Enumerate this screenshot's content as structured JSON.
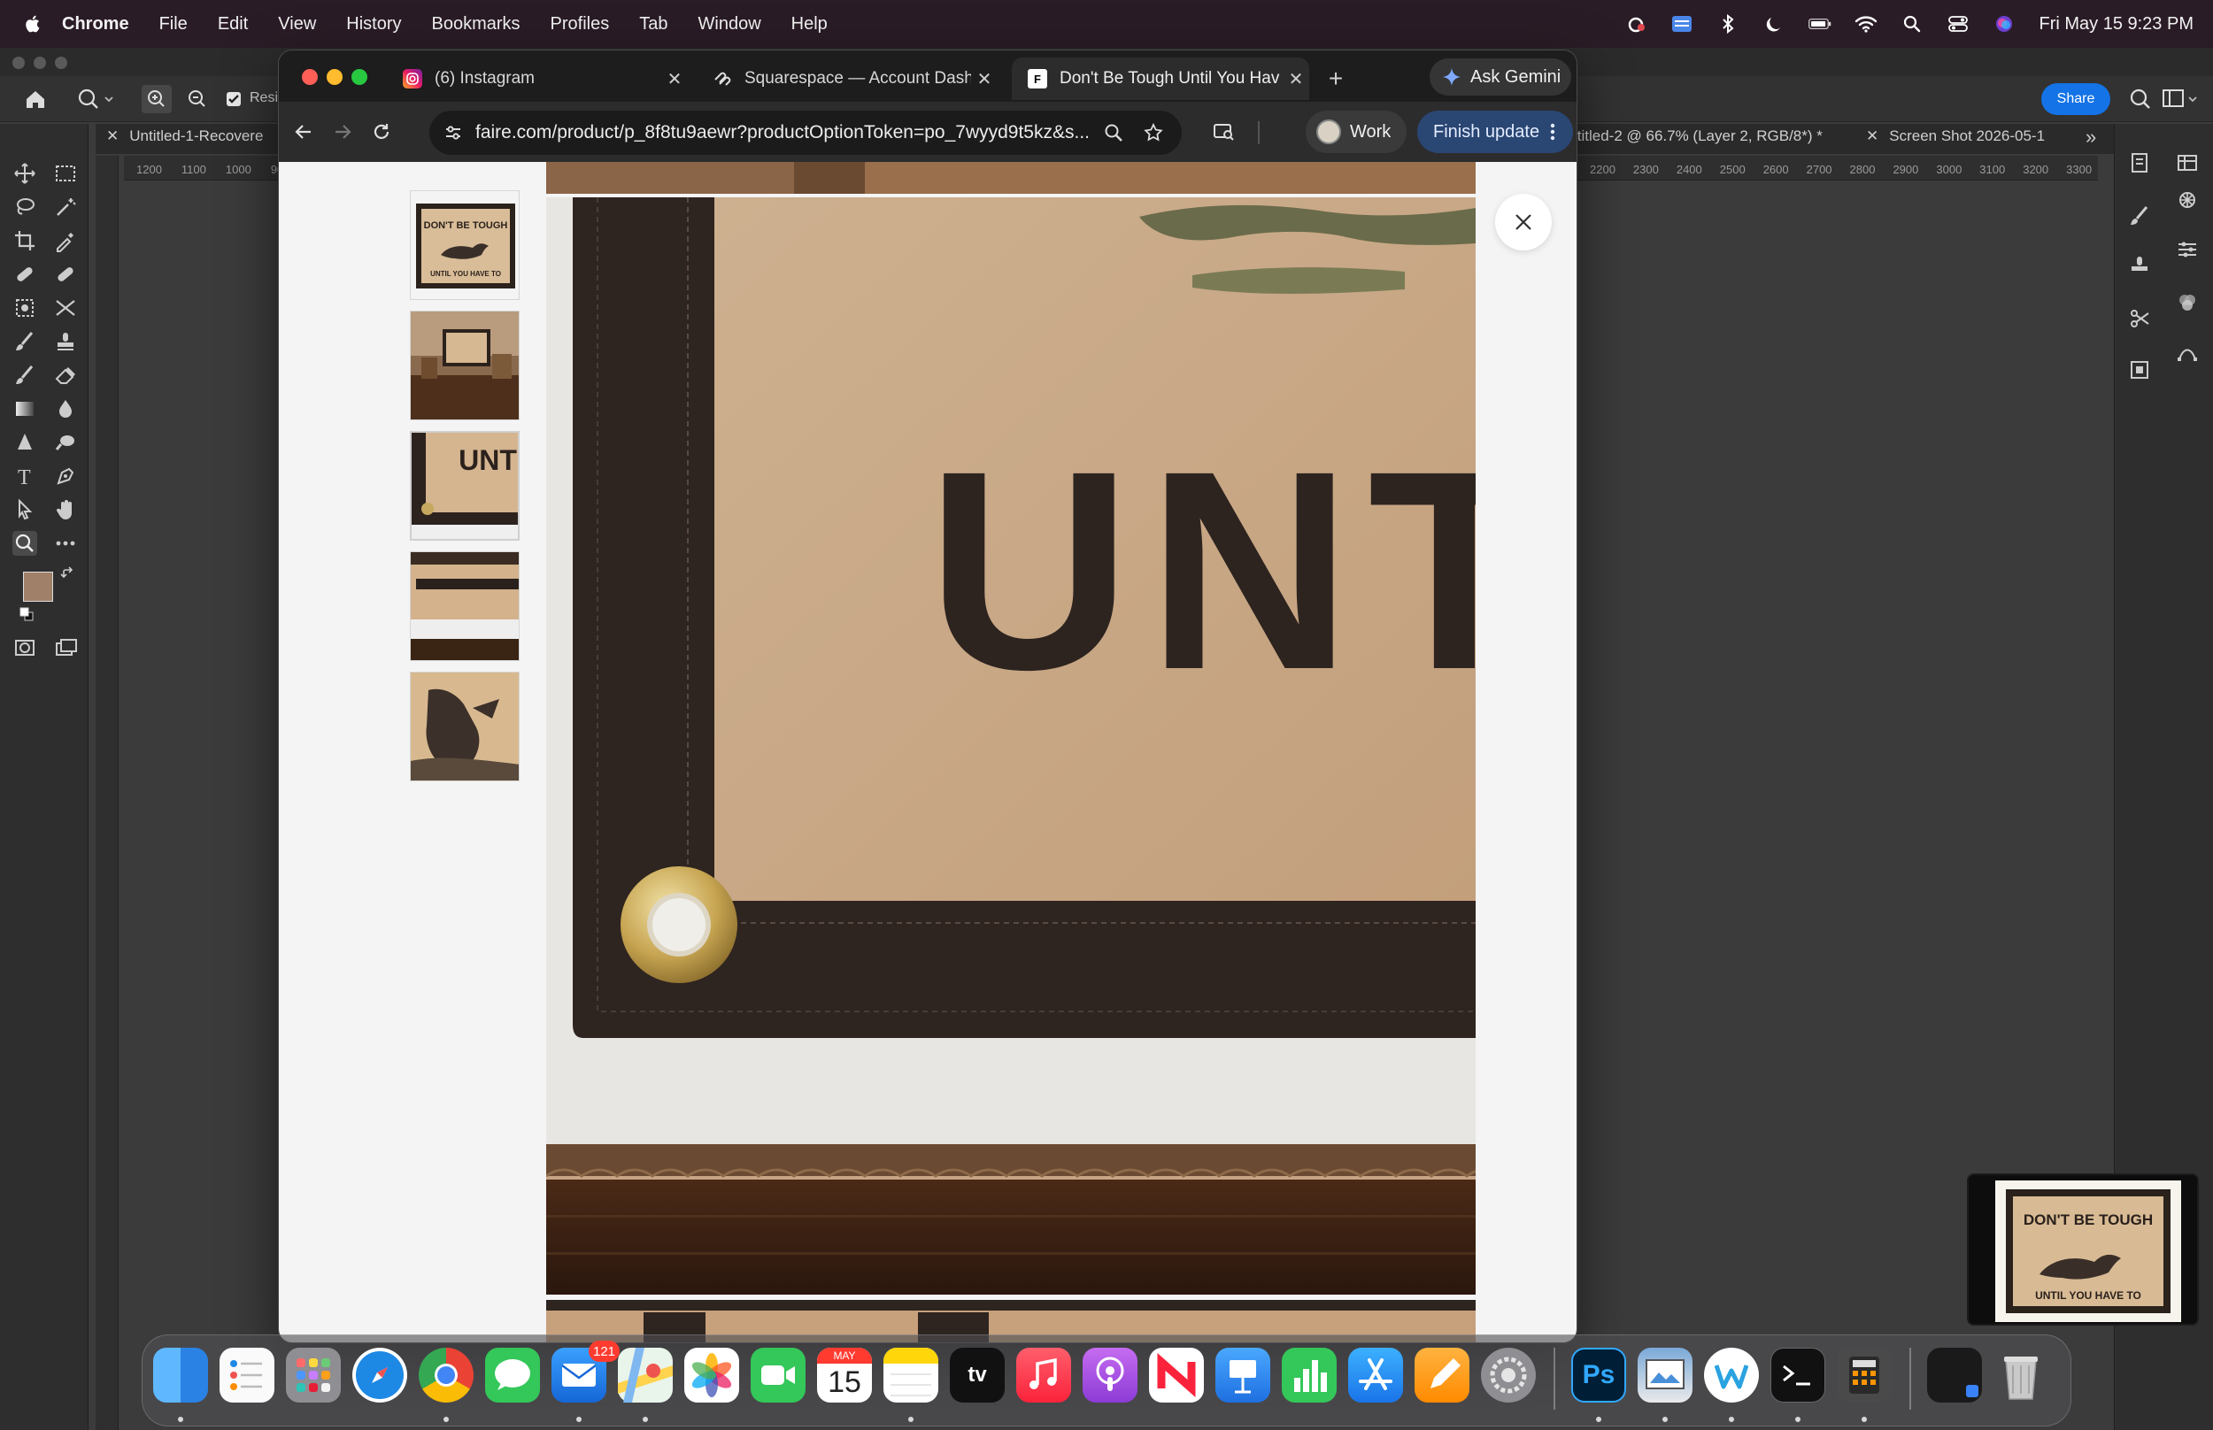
{
  "menubar": {
    "app_name": "Chrome",
    "items": [
      "File",
      "Edit",
      "View",
      "History",
      "Bookmarks",
      "Profiles",
      "Tab",
      "Window",
      "Help"
    ],
    "clock": "Fri May 15  9:23 PM"
  },
  "photoshop": {
    "tab_left": "Untitled-1-Recovere",
    "tab_right": "ititled-2 @ 66.7% (Layer 2, RGB/8*) *",
    "tab_right_2": "Screen Shot 2026-05-1",
    "option_checkbox_label": "Resi",
    "share_label": "Share",
    "ruler_top_left": [
      "1200",
      "1100",
      "1000",
      "90"
    ],
    "ruler_top_right": [
      "2200",
      "2300",
      "2400",
      "2500",
      "2600",
      "2700",
      "2800",
      "2900",
      "3000",
      "3100",
      "3200",
      "3300"
    ],
    "foreground_color": "#a08069",
    "background_color": "#111111"
  },
  "chrome": {
    "tabs": [
      {
        "title": "(6) Instagram",
        "favicon": "instagram-icon"
      },
      {
        "title": "Squarespace — Account Dash",
        "favicon": "squarespace-icon"
      },
      {
        "title": "Don't Be Tough Until You Hav",
        "favicon": "faire-icon",
        "favicon_letter": "F"
      }
    ],
    "gemini_label": "Ask Gemini",
    "url": "faire.com/product/p_8f8tu9aewr?productOptionToken=po_7wyyd9t5kz&s...",
    "profile_label": "Work",
    "finish_update_label": "Finish update"
  },
  "product": {
    "banner_line_1": "DON'T BE TOUGH",
    "banner_line_2": "UNTIL YOU HAVE TO",
    "closeup_text": "UNT",
    "thumbnail_count": 5,
    "selected_thumbnail": 3
  },
  "dock": {
    "mail_badge": "121",
    "calendar_month": "MAY",
    "calendar_day": "15",
    "ps_label": "Ps",
    "tv_label": "tv"
  }
}
